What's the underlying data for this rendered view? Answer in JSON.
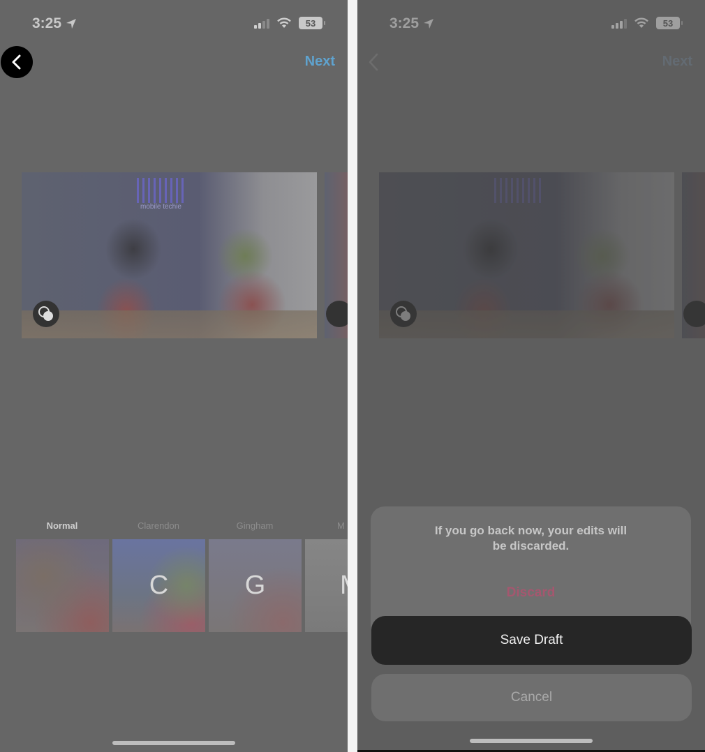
{
  "screens": {
    "left": {
      "status_bar": {
        "time": "3:25",
        "battery": "53",
        "signal_bars_active": 2,
        "signal_bars_total": 4
      },
      "nav": {
        "back_icon": "chevron-left-icon",
        "next_label": "Next"
      },
      "photo": {
        "brand_text": "iGeeksBlog",
        "brand_sub": "mobile techie",
        "multi_select_icon": "multiple-circles-icon"
      },
      "filters": [
        {
          "label": "Normal",
          "letter": "",
          "selected": true
        },
        {
          "label": "Clarendon",
          "letter": "C",
          "selected": false
        },
        {
          "label": "Gingham",
          "letter": "G",
          "selected": false
        },
        {
          "label": "M",
          "letter": "M",
          "selected": false
        }
      ]
    },
    "right": {
      "status_bar": {
        "time": "3:25",
        "battery": "53",
        "signal_bars_active": 3,
        "signal_bars_total": 4
      },
      "nav": {
        "back_icon": "chevron-left-icon",
        "next_label": "Next"
      },
      "dialog": {
        "message": "If you go back now, your edits will be discarded.",
        "discard_label": "Discard",
        "save_draft_label": "Save Draft",
        "cancel_label": "Cancel"
      }
    }
  },
  "colors": {
    "accent_next": "#5fa3cf",
    "discard": "#a5576f",
    "save_bg": "#262626"
  }
}
